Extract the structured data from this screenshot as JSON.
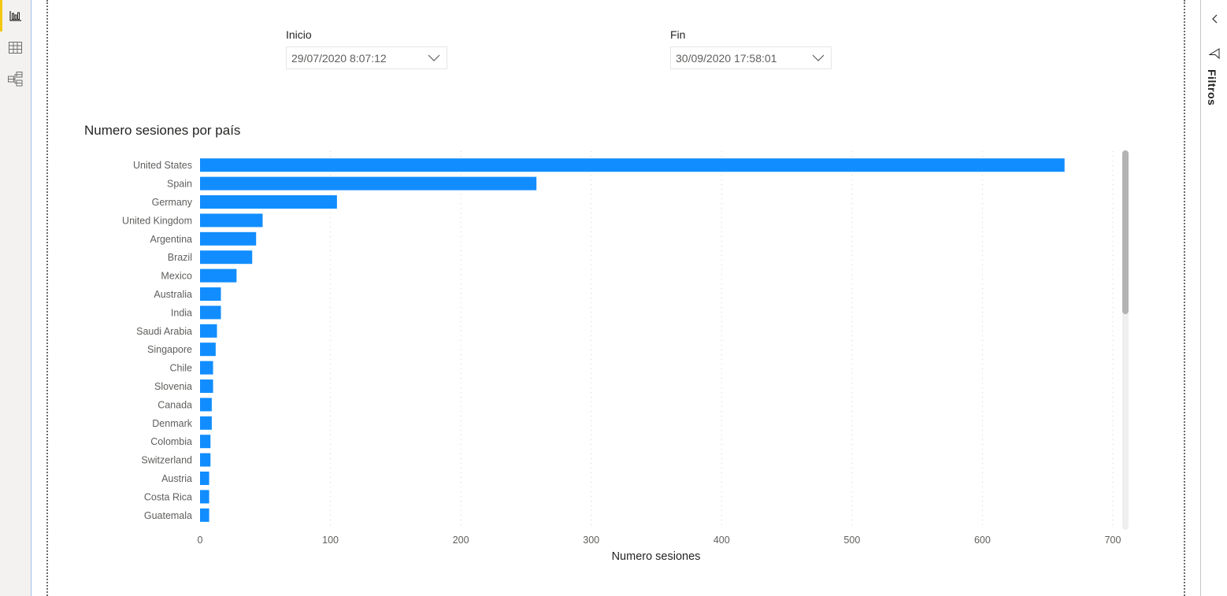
{
  "left_rail": {
    "items": [
      {
        "name": "report-view",
        "icon": "bar-chart-icon",
        "active": true
      },
      {
        "name": "data-view",
        "icon": "table-grid-icon",
        "active": false
      },
      {
        "name": "model-view",
        "icon": "model-diagram-icon",
        "active": false
      }
    ],
    "active_color": "#f2c811"
  },
  "slicers": {
    "start": {
      "label": "Inicio",
      "value": "29/07/2020 8:07:12"
    },
    "end": {
      "label": "Fin",
      "value": "30/09/2020 17:58:01"
    }
  },
  "right_pane": {
    "title": "Filtros",
    "collapse_icon": "chevron-left-icon",
    "filter_icon": "funnel-icon"
  },
  "chart_data": {
    "type": "bar",
    "orientation": "horizontal",
    "title": "Numero sesiones por país",
    "xlabel": "Numero sesiones",
    "ylabel": "",
    "xlim": [
      0,
      700
    ],
    "xticks": [
      0,
      100,
      200,
      300,
      400,
      500,
      600,
      700
    ],
    "grid": true,
    "bar_color": "#118dff",
    "categories": [
      "United States",
      "Spain",
      "Germany",
      "United Kingdom",
      "Argentina",
      "Brazil",
      "Mexico",
      "Australia",
      "India",
      "Saudi Arabia",
      "Singapore",
      "Chile",
      "Slovenia",
      "Canada",
      "Denmark",
      "Colombia",
      "Switzerland",
      "Austria",
      "Costa Rica",
      "Guatemala"
    ],
    "values": [
      663,
      258,
      105,
      48,
      43,
      40,
      28,
      16,
      16,
      13,
      12,
      10,
      10,
      9,
      9,
      8,
      8,
      7,
      7,
      7
    ]
  }
}
